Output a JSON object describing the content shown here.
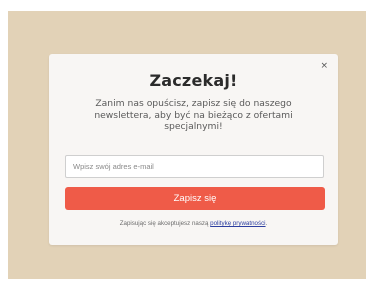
{
  "colors": {
    "backdrop": "#e2d2b7",
    "modal": "#f8f6f4",
    "button": "#ef5b48",
    "link": "#2d3fa0"
  },
  "modal": {
    "close_label": "×",
    "title": "Zaczekaj!",
    "description": "Zanim nas opuścisz, zapisz się do naszego newslettera, aby być na bieżąco z ofertami specjalnymi!",
    "email_placeholder": "Wpisz swój adres e-mail",
    "email_value": "",
    "submit_label": "Zapisz się",
    "privacy_prefix": "Zapisując się akceptujesz naszą ",
    "privacy_link": "politykę prywatności",
    "privacy_suffix": "."
  }
}
